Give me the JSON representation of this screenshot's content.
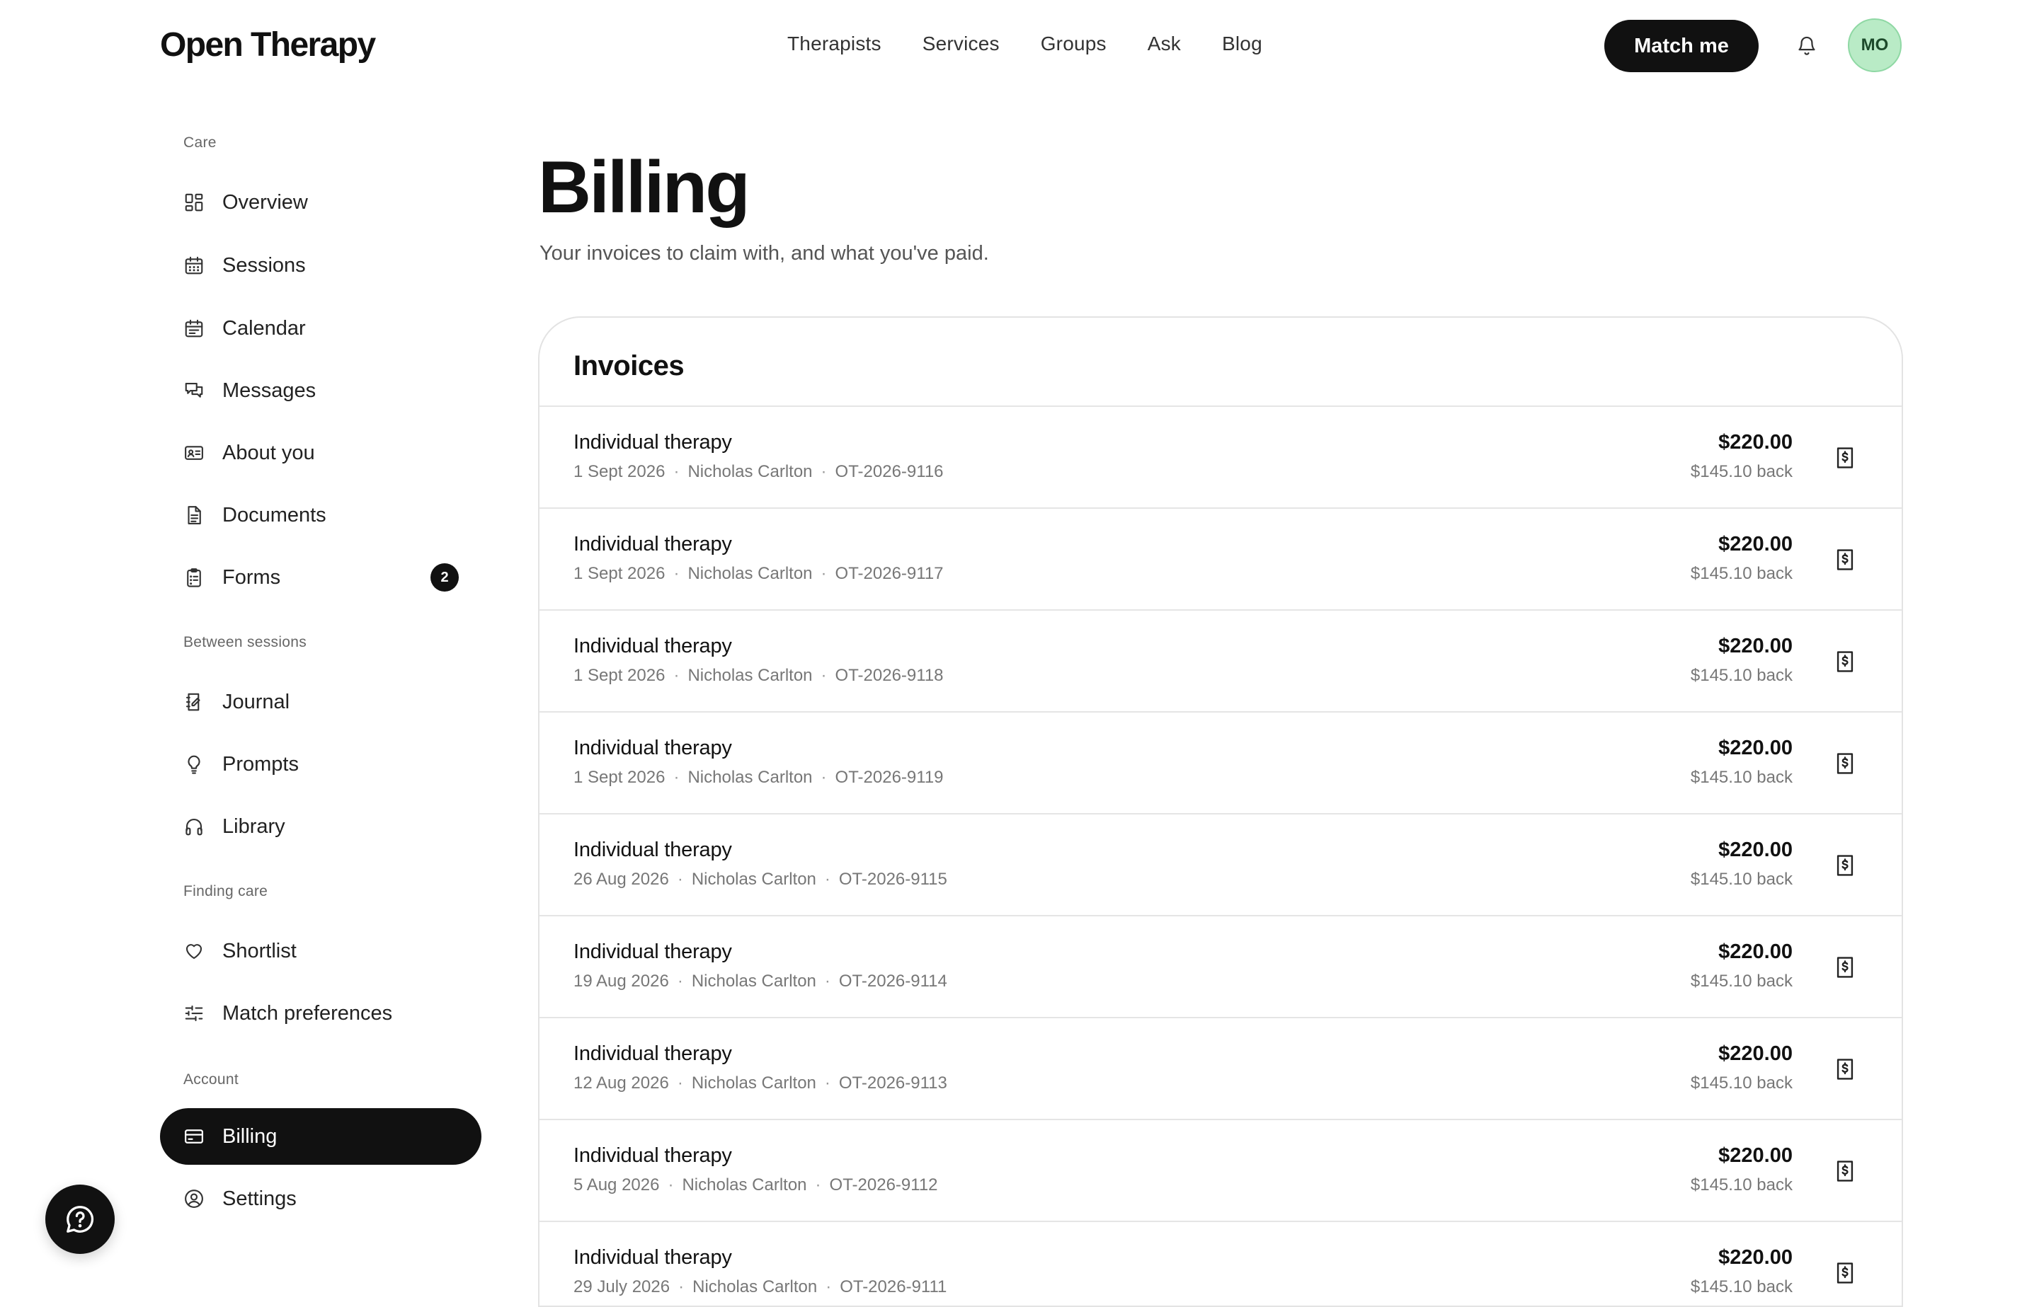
{
  "header": {
    "logo": "Open Therapy",
    "nav": [
      "Therapists",
      "Services",
      "Groups",
      "Ask",
      "Blog"
    ],
    "match_button": "Match me",
    "avatar_initials": "MO"
  },
  "sidebar": {
    "sections": [
      {
        "label": "Care",
        "items": [
          {
            "label": "Overview",
            "icon": "grid-icon"
          },
          {
            "label": "Sessions",
            "icon": "calendar-grid-icon"
          },
          {
            "label": "Calendar",
            "icon": "calendar-icon"
          },
          {
            "label": "Messages",
            "icon": "chat-bubbles-icon"
          },
          {
            "label": "About you",
            "icon": "id-card-icon"
          },
          {
            "label": "Documents",
            "icon": "document-icon"
          },
          {
            "label": "Forms",
            "icon": "clipboard-icon",
            "badge": "2"
          }
        ]
      },
      {
        "label": "Between sessions",
        "items": [
          {
            "label": "Journal",
            "icon": "journal-icon"
          },
          {
            "label": "Prompts",
            "icon": "lightbulb-icon"
          },
          {
            "label": "Library",
            "icon": "headphones-icon"
          }
        ]
      },
      {
        "label": "Finding care",
        "items": [
          {
            "label": "Shortlist",
            "icon": "heart-icon"
          },
          {
            "label": "Match preferences",
            "icon": "sliders-icon"
          }
        ]
      },
      {
        "label": "Account",
        "items": [
          {
            "label": "Billing",
            "icon": "credit-card-icon",
            "active": true
          },
          {
            "label": "Settings",
            "icon": "user-circle-icon"
          }
        ]
      }
    ]
  },
  "main": {
    "title": "Billing",
    "subtitle": "Your invoices to claim with, and what you've paid.",
    "invoices_title": "Invoices",
    "invoices": [
      {
        "title": "Individual therapy",
        "date": "1 Sept 2026",
        "therapist": "Nicholas Carlton",
        "id": "OT-2026-9116",
        "amount": "$220.00",
        "back": "$145.10 back"
      },
      {
        "title": "Individual therapy",
        "date": "1 Sept 2026",
        "therapist": "Nicholas Carlton",
        "id": "OT-2026-9117",
        "amount": "$220.00",
        "back": "$145.10 back"
      },
      {
        "title": "Individual therapy",
        "date": "1 Sept 2026",
        "therapist": "Nicholas Carlton",
        "id": "OT-2026-9118",
        "amount": "$220.00",
        "back": "$145.10 back"
      },
      {
        "title": "Individual therapy",
        "date": "1 Sept 2026",
        "therapist": "Nicholas Carlton",
        "id": "OT-2026-9119",
        "amount": "$220.00",
        "back": "$145.10 back"
      },
      {
        "title": "Individual therapy",
        "date": "26 Aug 2026",
        "therapist": "Nicholas Carlton",
        "id": "OT-2026-9115",
        "amount": "$220.00",
        "back": "$145.10 back"
      },
      {
        "title": "Individual therapy",
        "date": "19 Aug 2026",
        "therapist": "Nicholas Carlton",
        "id": "OT-2026-9114",
        "amount": "$220.00",
        "back": "$145.10 back"
      },
      {
        "title": "Individual therapy",
        "date": "12 Aug 2026",
        "therapist": "Nicholas Carlton",
        "id": "OT-2026-9113",
        "amount": "$220.00",
        "back": "$145.10 back"
      },
      {
        "title": "Individual therapy",
        "date": "5 Aug 2026",
        "therapist": "Nicholas Carlton",
        "id": "OT-2026-9112",
        "amount": "$220.00",
        "back": "$145.10 back"
      },
      {
        "title": "Individual therapy",
        "date": "29 July 2026",
        "therapist": "Nicholas Carlton",
        "id": "OT-2026-9111",
        "amount": "$220.00",
        "back": "$145.10 back"
      }
    ]
  }
}
